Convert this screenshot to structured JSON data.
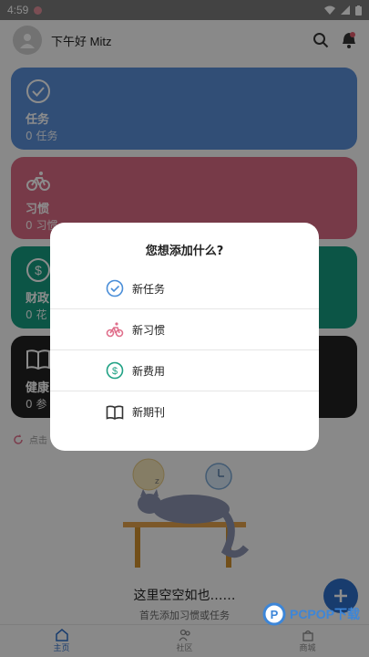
{
  "status": {
    "time": "4:59"
  },
  "header": {
    "greeting": "下午好 Mitz"
  },
  "cards": [
    {
      "title": "任务",
      "count": "0 任务",
      "icon": "check-circle-icon"
    },
    {
      "title": "习惯",
      "count": "0 习惯",
      "icon": "bike-icon"
    },
    {
      "title": "财政",
      "count": "0 花",
      "icon": "dollar-icon"
    },
    {
      "title": "健康",
      "count": "0 参",
      "icon": "book-icon"
    }
  ],
  "hint": "点击",
  "empty": {
    "title": "这里空空如也……",
    "subtitle": "首先添加习惯或任务"
  },
  "nav": [
    {
      "label": "主页"
    },
    {
      "label": "社区"
    },
    {
      "label": "商城"
    }
  ],
  "watermark": "PCPOP下载",
  "dialog": {
    "title": "您想添加什么?",
    "options": [
      {
        "label": "新任务",
        "icon": "check-circle-icon",
        "color": "#4a8ed8"
      },
      {
        "label": "新习惯",
        "icon": "bike-icon",
        "color": "#e0708c"
      },
      {
        "label": "新费用",
        "icon": "dollar-icon",
        "color": "#1fa184"
      },
      {
        "label": "新期刊",
        "icon": "book-icon",
        "color": "#333333"
      }
    ]
  }
}
